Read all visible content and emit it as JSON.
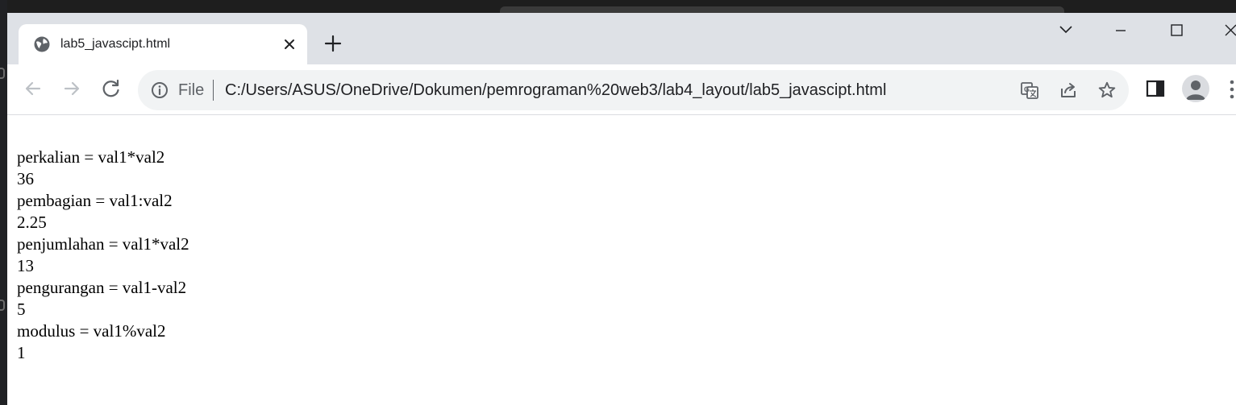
{
  "browser": {
    "tab": {
      "title": "lab5_javascipt.html"
    },
    "address_bar": {
      "scheme_label": "File",
      "url": "C:/Users/ASUS/OneDrive/Dokumen/pemrograman%20web3/lab4_layout/lab5_javascipt.html"
    },
    "icons": {
      "tab_favicon": "globe-icon",
      "tab_close": "close-icon",
      "new_tab": "plus-icon",
      "tab_search": "chevron-down-icon",
      "minimize": "minimize-icon",
      "maximize": "maximize-icon",
      "close_window": "close-icon",
      "back": "arrow-left-icon",
      "forward": "arrow-right-icon",
      "reload": "reload-icon",
      "site_info": "info-icon",
      "translate": "translate-icon",
      "share": "share-icon",
      "bookmark": "star-icon",
      "side_panel": "side-panel-icon",
      "profile": "avatar-icon",
      "menu": "kebab-menu-icon"
    }
  },
  "page": {
    "lines": [
      "perkalian = val1*val2",
      "36",
      "pembagian = val1:val2",
      "2.25",
      "penjumlahan = val1*val2",
      "13",
      "pengurangan = val1-val2",
      "5",
      "modulus = val1%val2",
      "1"
    ]
  },
  "colors": {
    "tabstrip": "#dee1e6",
    "omnibox": "#f1f3f4",
    "icon": "#5f6368"
  }
}
